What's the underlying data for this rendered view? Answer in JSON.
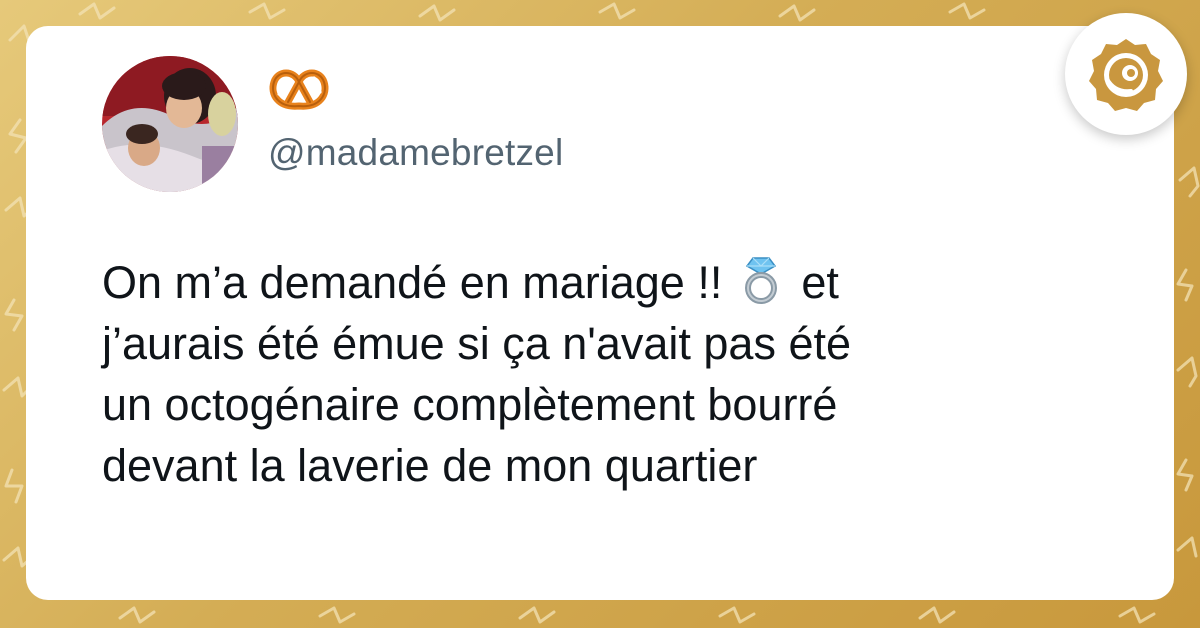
{
  "tweet": {
    "display_name_emoji": "pretzel-icon",
    "handle": "@madamebretzel",
    "lines": [
      "On m’a demandé en mariage !!",
      "et",
      "j’aurais été émue si ça n'avait pas été",
      "un octogénaire complètement bourré",
      "devant la laverie de mon quartier"
    ],
    "inline_emoji": "ring-icon"
  },
  "colors": {
    "background": "#d4ad55",
    "card": "#ffffff",
    "text": "#0f1419",
    "handle": "#536471",
    "brand_gold": "#c9973f"
  }
}
